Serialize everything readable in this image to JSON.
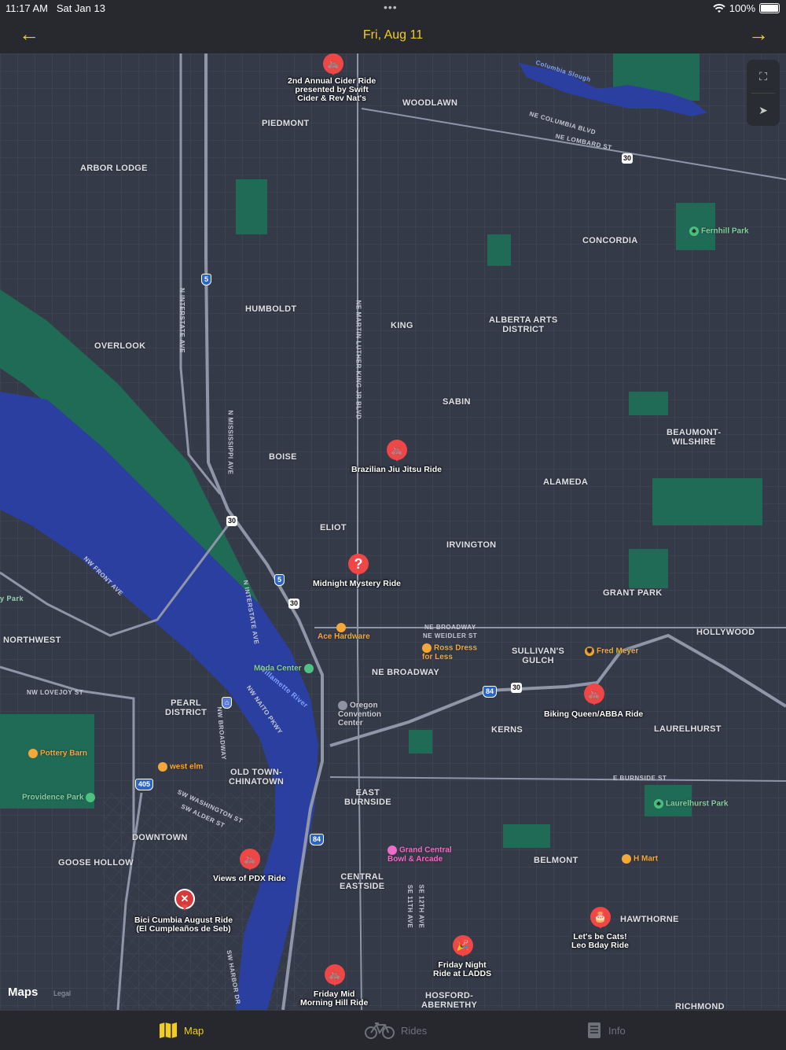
{
  "status": {
    "time": "11:17 AM",
    "date": "Sat Jan 13",
    "battery": "100%"
  },
  "nav": {
    "title": "Fri, Aug 11",
    "back_icon": "arrow-left-icon",
    "forward_icon": "arrow-right-icon"
  },
  "map": {
    "controls": {
      "fullscreen_icon": "fullscreen-icon",
      "location_icon": "location-arrow-icon"
    },
    "logo": "Maps",
    "legal": "Legal",
    "neighborhoods": {
      "woodlawn": "WOODLAWN",
      "piedmont": "PIEDMONT",
      "arbor_lodge": "ARBOR LODGE",
      "concordia": "CONCORDIA",
      "humboldt": "HUMBOLDT",
      "king": "KING",
      "alberta": "ALBERTA ARTS\nDISTRICT",
      "overlook": "OVERLOOK",
      "sabin": "SABIN",
      "beaumont": "BEAUMONT-\nWILSHIRE",
      "boise": "BOISE",
      "alameda": "ALAMEDA",
      "eliot": "ELIOT",
      "irvington": "IRVINGTON",
      "grant_park": "GRANT PARK",
      "northwest": "NORTHWEST",
      "hollywood": "HOLLYWOOD",
      "sullivans": "SULLIVAN'S\nGULCH",
      "ne_broadway": "NE BROADWAY",
      "pearl": "PEARL\nDISTRICT",
      "kerns": "KERNS",
      "laurelhurst": "LAURELHURST",
      "old_town": "OLD TOWN-\nCHINATOWN",
      "east_burnside": "EAST\nBURNSIDE",
      "downtown": "DOWNTOWN",
      "goose_hollow": "GOOSE HOLLOW",
      "belmont": "BELMONT",
      "central_eastside": "CENTRAL\nEASTSIDE",
      "hawthorne": "HAWTHORNE",
      "hosford": "HOSFORD-\nABERNETHY",
      "richmond": "RICHMOND"
    },
    "streets": {
      "columbia_slough": "Columbia Slough",
      "ne_columbia": "NE COLUMBIA BLVD",
      "ne_lombard": "NE LOMBARD ST",
      "n_interstate": "N INTERSTATE AVE",
      "mlk": "NE MARTIN LUTHER KING JR BLVD",
      "n_mississippi": "N MISSISSIPPI AVE",
      "nw_front": "NW FRONT AVE",
      "n_interstate2": "N INTERSTATE AVE",
      "ne_broadway_st": "NE BROADWAY",
      "ne_weidler": "NE WEIDLER ST",
      "nw_lovejoy": "NW LOVEJOY ST",
      "nw_naito": "NW NAITO PKWY",
      "willamette": "Willamette River",
      "nw_broadway": "NW BROADWAY",
      "e_burnside": "E BURNSIDE ST",
      "sw_washington": "SW WASHINGTON ST",
      "sw_alder": "SW ALDER ST",
      "se_12th": "SE 12TH AVE",
      "se_11th": "SE 11TH AVE",
      "s_harbor": "SW HARBOR DR",
      "y_park": "y Park"
    },
    "pois": {
      "fernhill": "Fernhill Park",
      "ace": "Ace Hardware",
      "ross": "Ross Dress\nfor Less",
      "fred_meyer": "Fred Meyer",
      "moda": "Moda Center",
      "oregon_cc": "Oregon\nConvention\nCenter",
      "pottery_barn": "Pottery Barn",
      "west_elm": "west elm",
      "providence": "Providence Park",
      "laurelhurst_park": "Laurelhurst Park",
      "grand_central": "Grand Central\nBowl & Arcade",
      "h_mart": "H Mart"
    },
    "shields": {
      "i5a": "5",
      "us30a": "30",
      "i5b": "5",
      "us30b": "30",
      "us30c": "30",
      "i84a": "84",
      "us30d": "30",
      "i405": "405",
      "i84b": "84",
      "us30e": "30"
    },
    "rides": [
      {
        "name": "2nd Annual Cider Ride\npresented by Swift\nCider & Rev Nat's",
        "icon": "bicycle-icon",
        "glyph": "🚲"
      },
      {
        "name": "Brazilian Jiu Jitsu Ride",
        "icon": "bicycle-icon",
        "glyph": "🚲"
      },
      {
        "name": "Midnight Mystery Ride",
        "icon": "question-mark-icon",
        "glyph": "?"
      },
      {
        "name": "Biking Queen/ABBA Ride",
        "icon": "bicycle-icon",
        "glyph": "🚲"
      },
      {
        "name": "Views of PDX Ride",
        "icon": "bicycle-icon",
        "glyph": "🚲"
      },
      {
        "name": "Bici Cumbia August Ride\n(El Cumpleaños de Seb)",
        "icon": "cancelled-icon",
        "glyph": "✕"
      },
      {
        "name": "Let's be Cats!\nLeo Bday Ride",
        "icon": "birthday-cake-icon",
        "glyph": "🎂"
      },
      {
        "name": "Friday Night\nRide at LADDS",
        "icon": "party-popper-icon",
        "glyph": "🎉"
      },
      {
        "name": "Friday Mid\nMorning Hill Ride",
        "icon": "bicycle-icon",
        "glyph": "🚲"
      }
    ]
  },
  "tabs": [
    {
      "label": "Map",
      "icon": "map-icon"
    },
    {
      "label": "Rides",
      "icon": "bicycle-icon"
    },
    {
      "label": "Info",
      "icon": "document-icon"
    }
  ],
  "colors": {
    "accent": "#f2cd1f",
    "pin": "#ef4646",
    "water": "#2b3fa0",
    "park": "#1f6b55",
    "map_bg": "#353a48"
  }
}
